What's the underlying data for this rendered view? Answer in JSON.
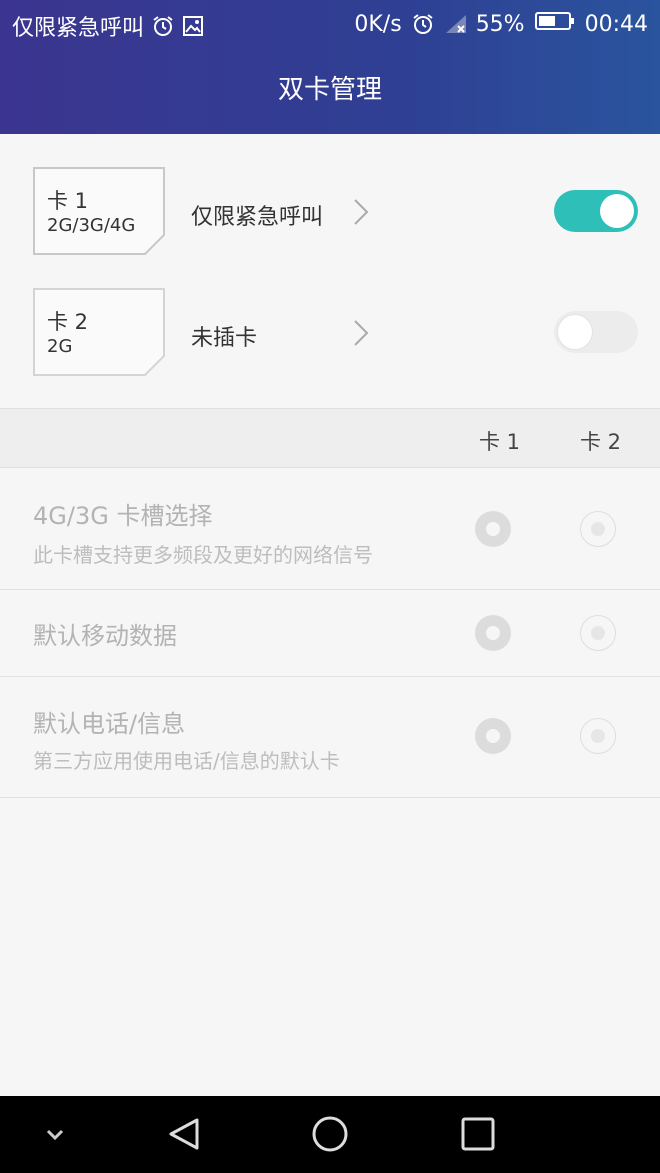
{
  "status_bar": {
    "carrier_text": "仅限紧急呼叫",
    "net_speed": "0K/s",
    "battery": "55%",
    "time": "00:44",
    "icons": [
      "alarm-icon",
      "image-icon",
      "alarm-icon",
      "signal-icon",
      "battery-icon"
    ]
  },
  "header": {
    "title": "双卡管理"
  },
  "sims": [
    {
      "name": "卡 1",
      "type": "2G/3G/4G",
      "status": "仅限紧急呼叫",
      "enabled": true
    },
    {
      "name": "卡 2",
      "type": "2G",
      "status": "未插卡",
      "enabled": false
    }
  ],
  "columns": {
    "card1": "卡 1",
    "card2": "卡 2"
  },
  "options": [
    {
      "title": "4G/3G 卡槽选择",
      "subtitle": "此卡槽支持更多频段及更好的网络信号"
    },
    {
      "title": "默认移动数据",
      "subtitle": ""
    },
    {
      "title": "默认电话/信息",
      "subtitle": "第三方应用使用电话/信息的默认卡"
    }
  ],
  "colors": {
    "accent": "#2ebfb9",
    "header_bg": "#33409a"
  },
  "nav_bar": {
    "icons": [
      "chevron-down-icon",
      "back-icon",
      "home-icon",
      "recents-icon"
    ]
  }
}
